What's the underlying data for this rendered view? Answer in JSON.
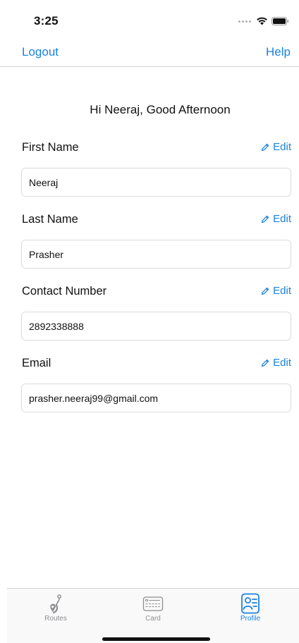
{
  "status_bar": {
    "time": "3:25"
  },
  "nav": {
    "logout_label": "Logout",
    "help_label": "Help"
  },
  "greeting": "Hi Neeraj, Good Afternoon",
  "edit_label": "Edit",
  "fields": [
    {
      "label": "First Name",
      "value": "Neeraj"
    },
    {
      "label": "Last Name",
      "value": "Prasher"
    },
    {
      "label": "Contact Number",
      "value": "2892338888"
    },
    {
      "label": "Email",
      "value": "prasher.neeraj99@gmail.com"
    }
  ],
  "tabs": [
    {
      "label": "Routes",
      "icon": "route-pin-icon",
      "active": false
    },
    {
      "label": "Card",
      "icon": "card-icon",
      "active": false
    },
    {
      "label": "Profile",
      "icon": "profile-icon",
      "active": true
    }
  ],
  "colors": {
    "accent": "#1a82e2",
    "inactive_tab": "#8e8e93",
    "divider": "#d1d1d6"
  }
}
